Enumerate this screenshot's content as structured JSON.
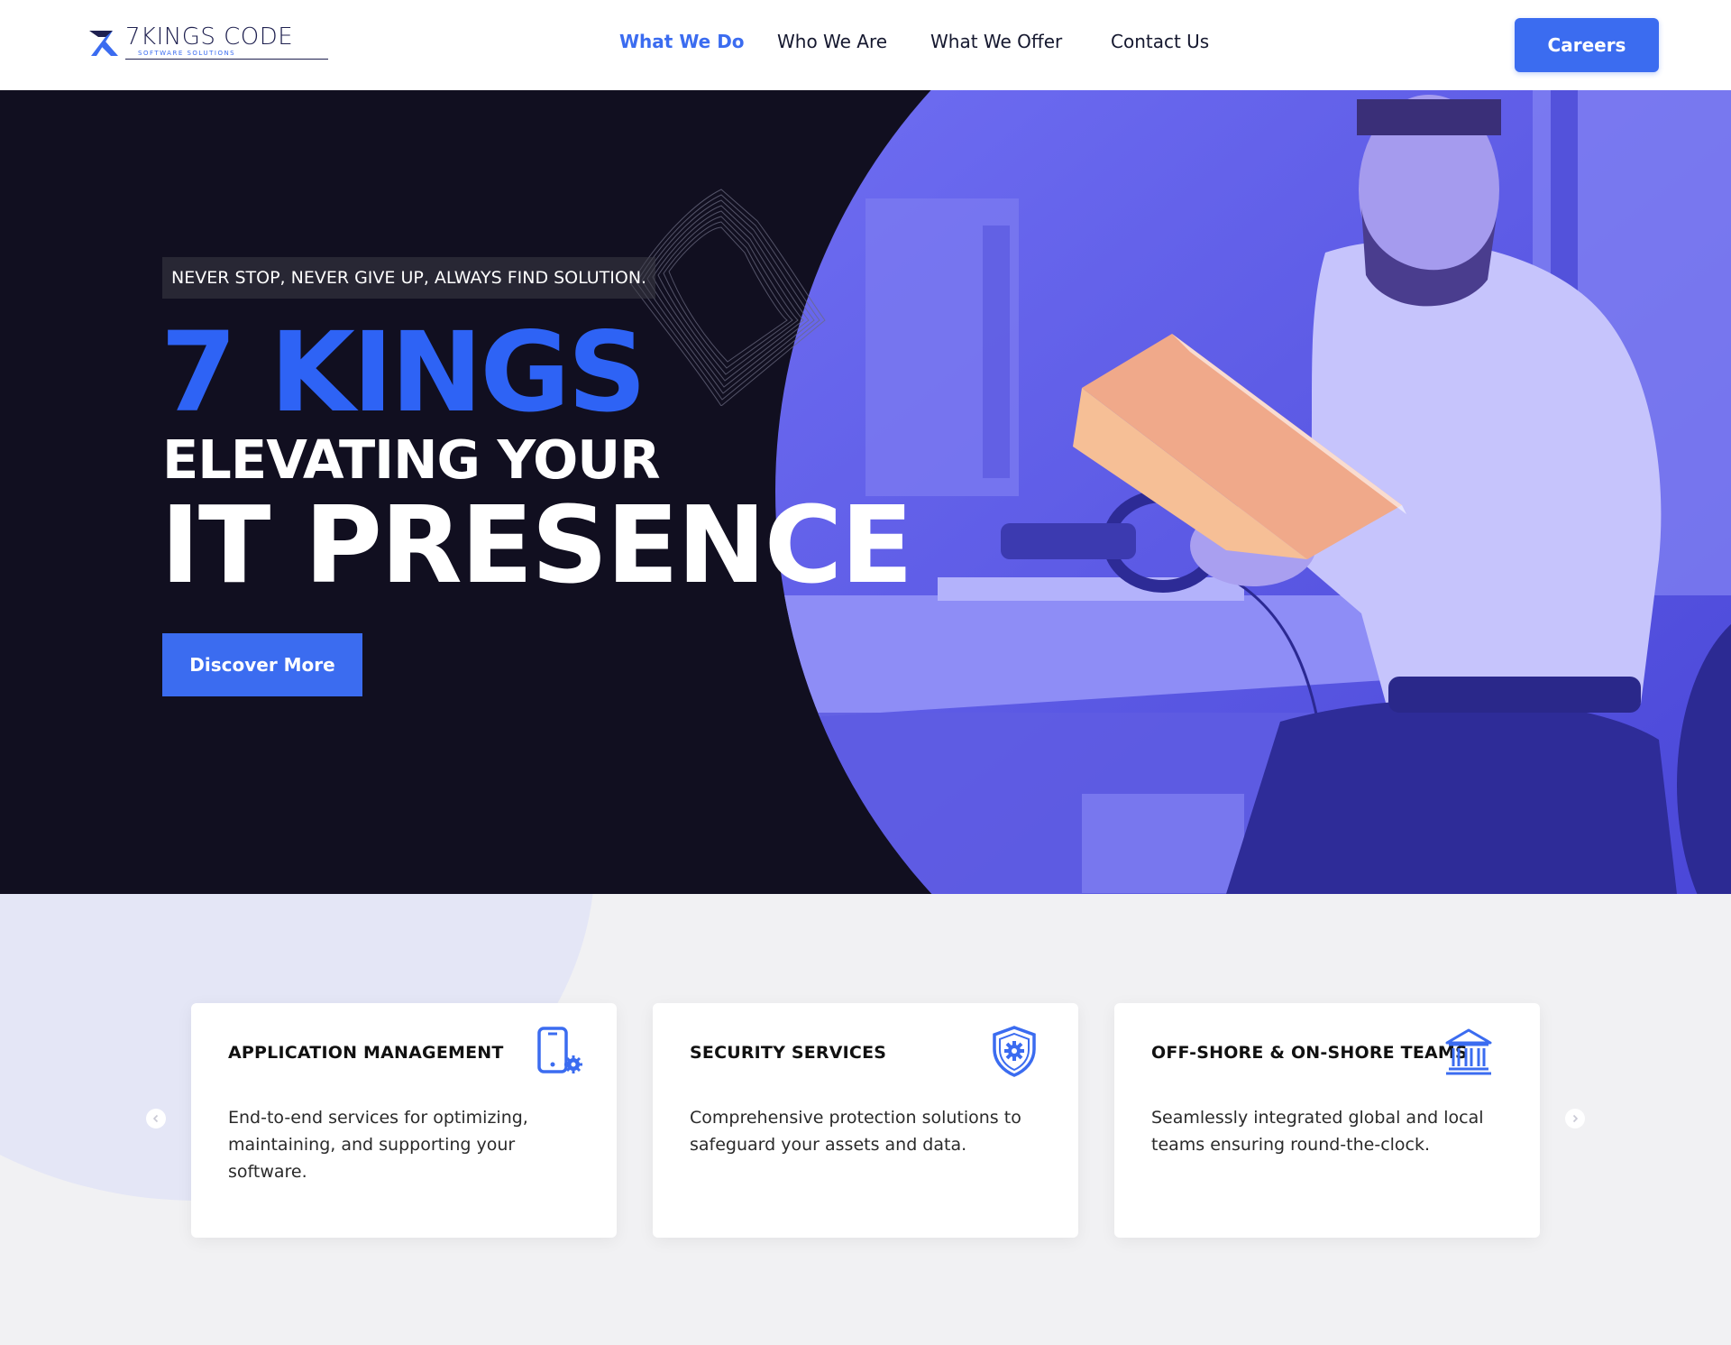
{
  "brand": {
    "name": "7KINGS CODE",
    "tagline": "SOFTWARE SOLUTIONS",
    "accent_color": "#3b6cf0"
  },
  "nav": {
    "items": [
      {
        "label": "What We Do",
        "active": true
      },
      {
        "label": "Who We Are",
        "active": false
      },
      {
        "label": "What We Offer",
        "active": false
      },
      {
        "label": "Contact Us",
        "active": false
      }
    ],
    "cta_label": "Careers"
  },
  "hero": {
    "tagline": "NEVER STOP, NEVER GIVE UP, ALWAYS FIND SOLUTION.",
    "headline_brand": "7 KINGS",
    "headline_line1": "ELEVATING YOUR",
    "headline_line2": "IT PRESENCE",
    "cta_label": "Discover More",
    "background_color": "#110f20",
    "overlay_color": "#6f6cf0"
  },
  "services": {
    "cards": [
      {
        "title": "APPLICATION MANAGEMENT",
        "description": "End-to-end services for optimizing, maintaining, and supporting your software.",
        "icon": "mobile-gear-icon"
      },
      {
        "title": "SECURITY SERVICES",
        "description": "Comprehensive protection solutions to safeguard your assets and data.",
        "icon": "shield-gear-icon"
      },
      {
        "title": "OFF-SHORE & ON-SHORE TEAMS",
        "description": "Seamlessly integrated global and local teams ensuring round-the-clock.",
        "icon": "institution-icon"
      }
    ]
  }
}
